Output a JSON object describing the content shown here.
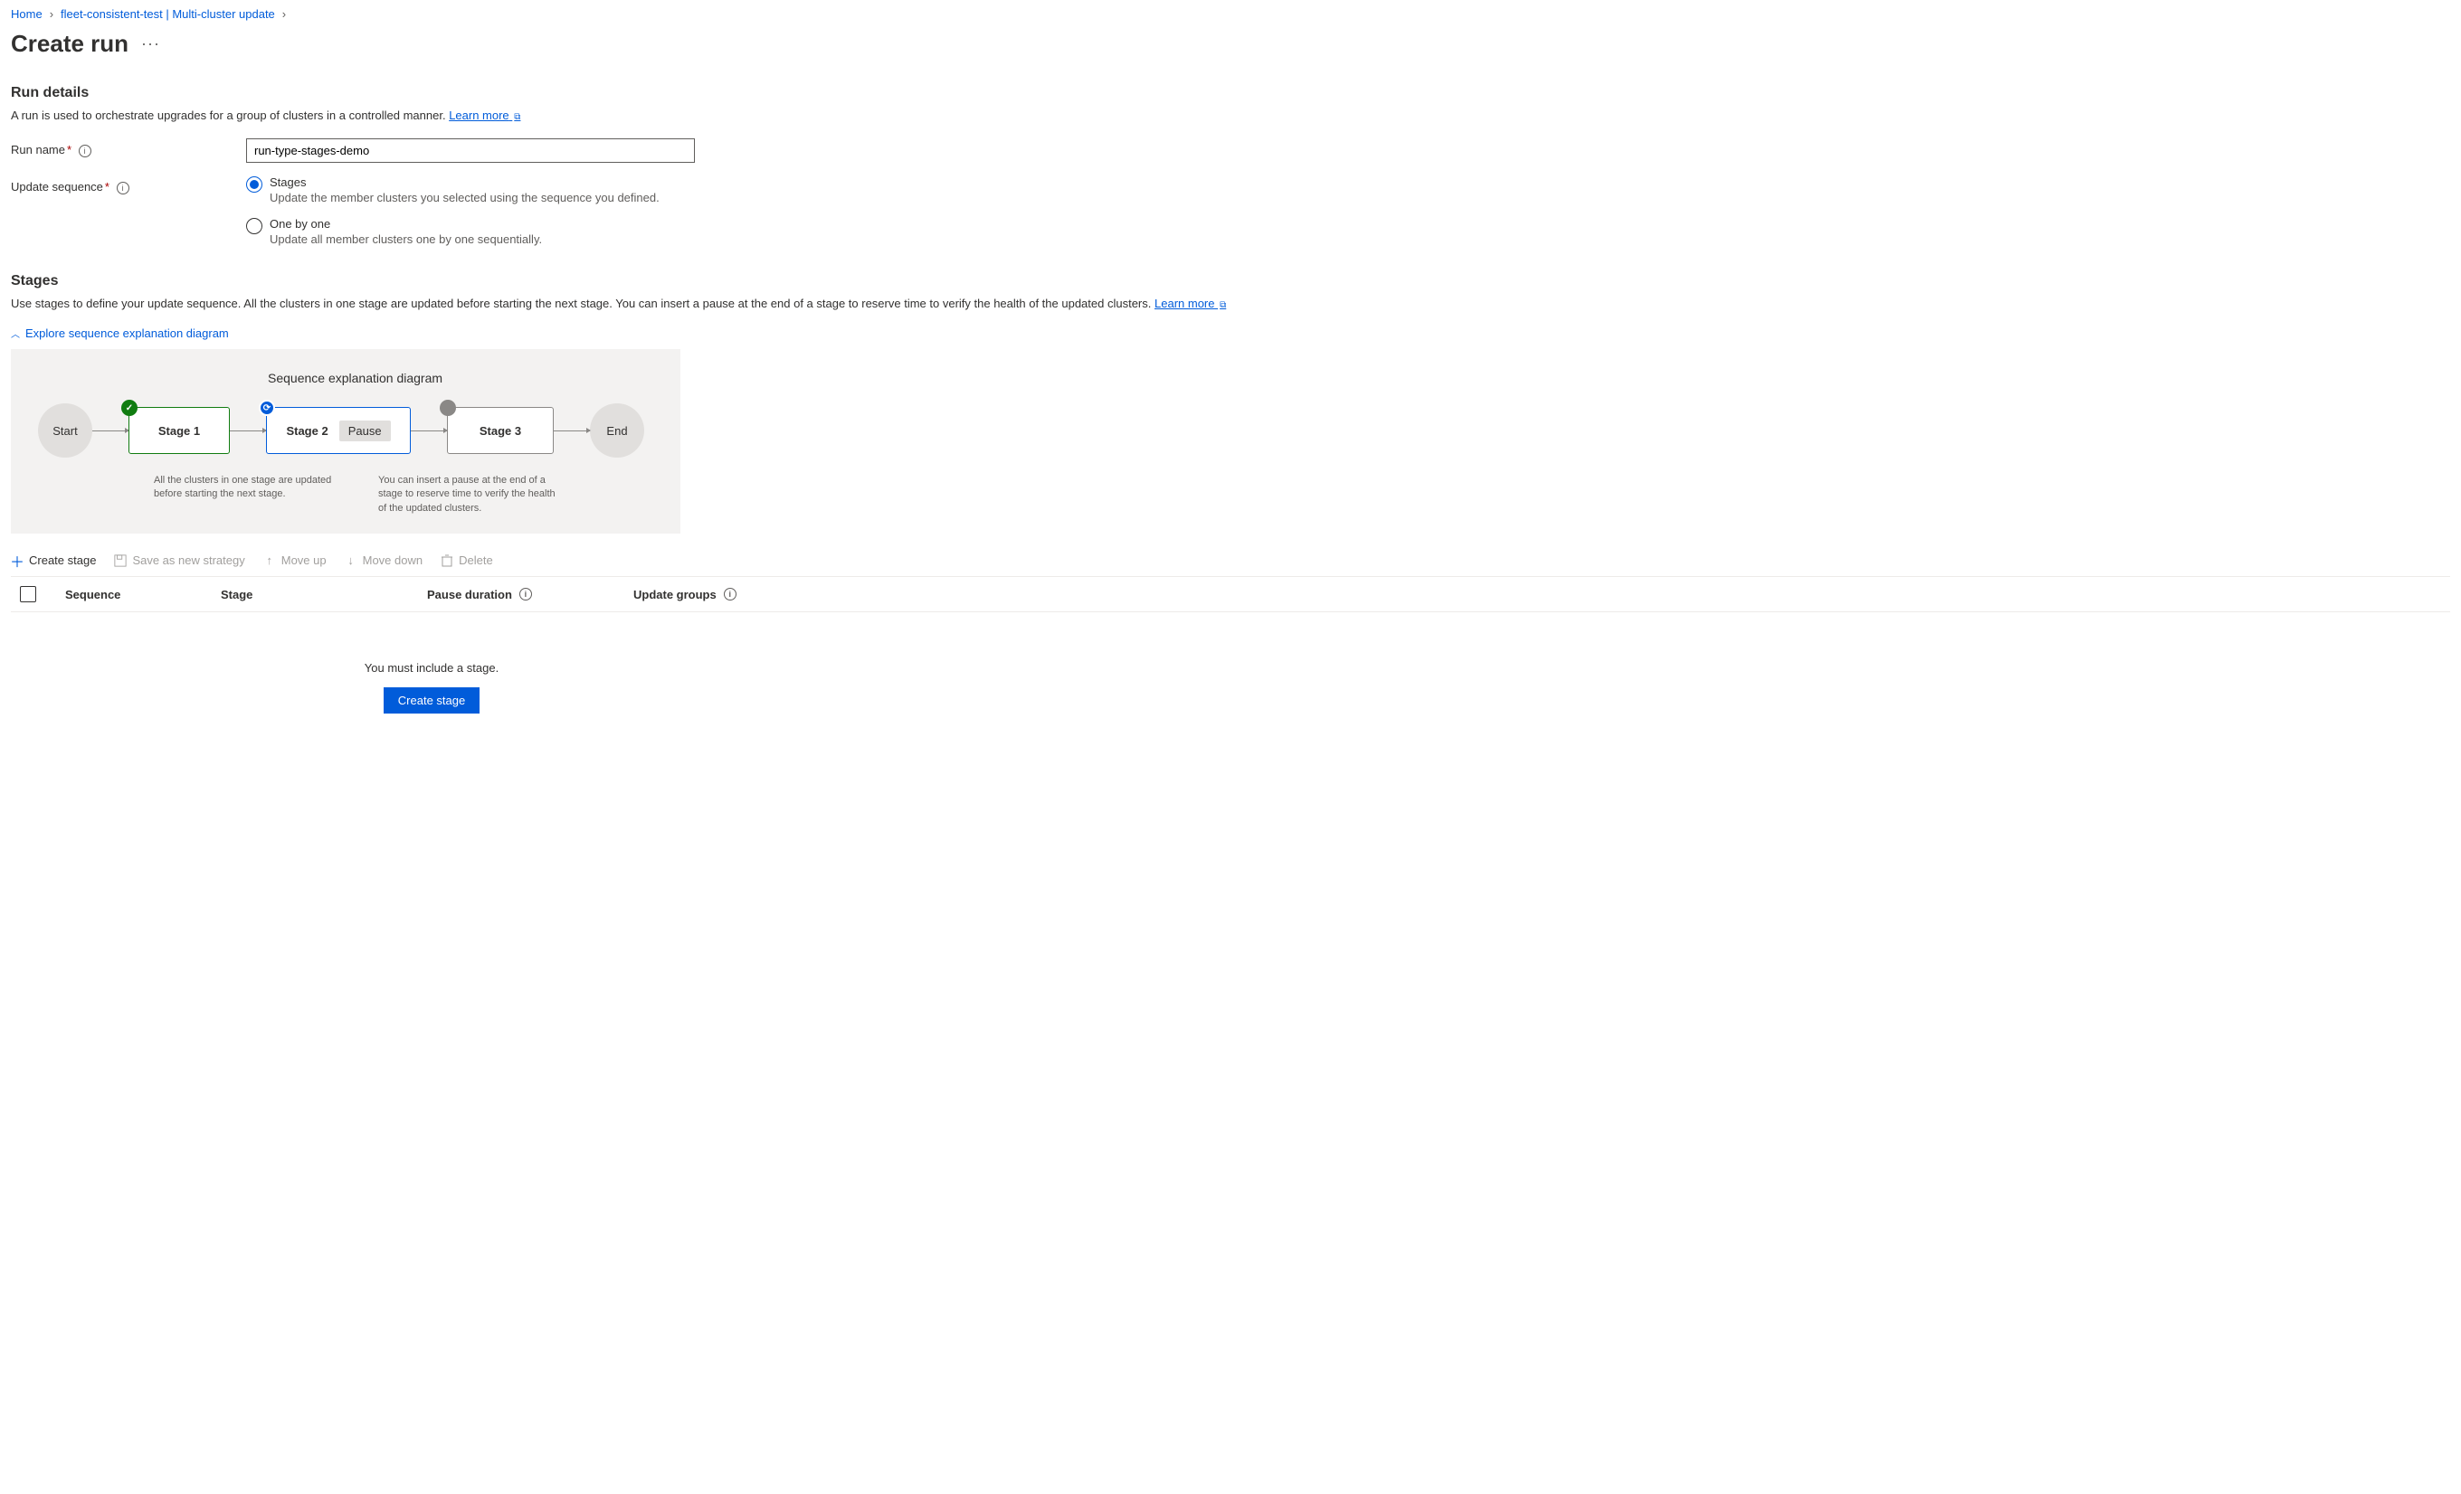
{
  "breadcrumb": {
    "home": "Home",
    "parent": "fleet-consistent-test | Multi-cluster update"
  },
  "page": {
    "title": "Create run"
  },
  "run_details": {
    "heading": "Run details",
    "desc": "A run is used to orchestrate upgrades for a group of clusters in a controlled manner.",
    "learn_more": "Learn more"
  },
  "form": {
    "run_name_label": "Run name",
    "run_name_value": "run-type-stages-demo",
    "update_seq_label": "Update sequence",
    "radio_stages_title": "Stages",
    "radio_stages_desc": "Update the member clusters you selected using the sequence you defined.",
    "radio_one_title": "One by one",
    "radio_one_desc": "Update all member clusters one by one sequentially."
  },
  "stages": {
    "heading": "Stages",
    "desc": "Use stages to define your update sequence. All the clusters in one stage are updated before starting the next stage. You can insert a pause at the end of a stage to reserve time to verify the health of the updated clusters.",
    "learn_more": "Learn more",
    "explore_label": "Explore sequence explanation diagram"
  },
  "diagram": {
    "title": "Sequence explanation diagram",
    "start": "Start",
    "stage1": "Stage 1",
    "stage2": "Stage 2",
    "pause": "Pause",
    "stage3": "Stage 3",
    "end": "End",
    "note1": "All the clusters in one stage are updated before starting the next stage.",
    "note2": "You can insert a pause at the end of a stage to reserve time to verify the health of the updated clusters."
  },
  "toolbar": {
    "create_stage": "Create stage",
    "save_strategy": "Save as new strategy",
    "move_up": "Move up",
    "move_down": "Move down",
    "delete": "Delete"
  },
  "table": {
    "col_sequence": "Sequence",
    "col_stage": "Stage",
    "col_pause": "Pause duration",
    "col_groups": "Update groups"
  },
  "empty": {
    "message": "You must include a stage.",
    "button": "Create stage"
  }
}
